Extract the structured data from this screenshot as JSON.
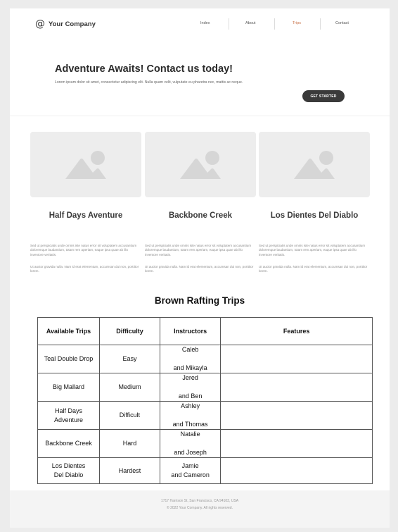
{
  "header": {
    "logo_mark": "@",
    "logo_text": "Your Company",
    "nav": [
      {
        "label": "Index",
        "active": false
      },
      {
        "label": "About",
        "active": false
      },
      {
        "label": "Trips",
        "active": true
      },
      {
        "label": "Contact",
        "active": false
      }
    ]
  },
  "hero": {
    "title": "Adventure Awaits! Contact us today!",
    "text": "Lorem ipsum dolor sit amet, consectetur adipiscing elit. Nulla quam velit, vulputate eu pharetra nec, mattis ac neque.",
    "cta": "GET STARTED"
  },
  "cards": [
    {
      "title": "Half Days Aventure",
      "p1": "Sed ut perspiciatis unde omnis iste natus error sit voluptatem accusantium doloremque laudantium, totam rem aperiam, eaque ipsa quae ab illo inventore veritatis.",
      "p2": "Ut auctor gravida nulla. Nam id erat elementum, accumsan dui non, porttitor lorem."
    },
    {
      "title": "Backbone Creek",
      "p1": "Sed ut perspiciatis unde omnis iste natus error sit voluptatem accusantium doloremque laudantium, totam rem aperiam, eaque ipsa quae ab illo inventore veritatis.",
      "p2": "Ut auctor gravida nulla. Nam id erat elementum, accumsan dui non, porttitor lorem."
    },
    {
      "title": "Los Dientes Del Diablo",
      "p1": "Sed ut perspiciatis unde omnis iste natus error sit voluptatem accusantium doloremque laudantium, totam rem aperiam, eaque ipsa quae ab illo inventore veritatis.",
      "p2": "Ut auctor gravida nulla. Nam id erat elementum, accumsan dui non, porttitor lorem."
    }
  ],
  "trips_table": {
    "title": "Brown Rafting Trips",
    "headers": [
      "Available Trips",
      "Difficulty",
      "Instructors",
      "Features"
    ],
    "rows": [
      {
        "trip": "Teal Double Drop",
        "difficulty": "Easy",
        "instructors": "Caleb\n\nand Mikayla",
        "features": ""
      },
      {
        "trip": "Big Mallard",
        "difficulty": "Medium",
        "instructors": "Jered\n\nand Ben",
        "features": ""
      },
      {
        "trip": "Half Days\nAdventure",
        "difficulty": "Difficult",
        "instructors": "Ashley\n\nand Thomas",
        "features": ""
      },
      {
        "trip": "Backbone Creek",
        "difficulty": "Hard",
        "instructors": "Natalie\n\nand Joseph",
        "features": ""
      },
      {
        "trip": "Los Dientes\nDel Diablo",
        "difficulty": "Hardest",
        "instructors": "Jamie\nand Cameron",
        "features": ""
      }
    ]
  },
  "footer": {
    "address": "1717 Harrison St, San Francisco, CA 94103, USA",
    "copyright": "© 2022 Your Company.  All rights reserved."
  },
  "colors": {
    "accent": "#c8734a",
    "cta_bg": "#3a3a3a",
    "placeholder_bg": "#ededed",
    "placeholder_icon": "#d6d6d6"
  },
  "icons": {
    "logo": "at-sign-icon",
    "card_image": "image-placeholder-icon"
  }
}
